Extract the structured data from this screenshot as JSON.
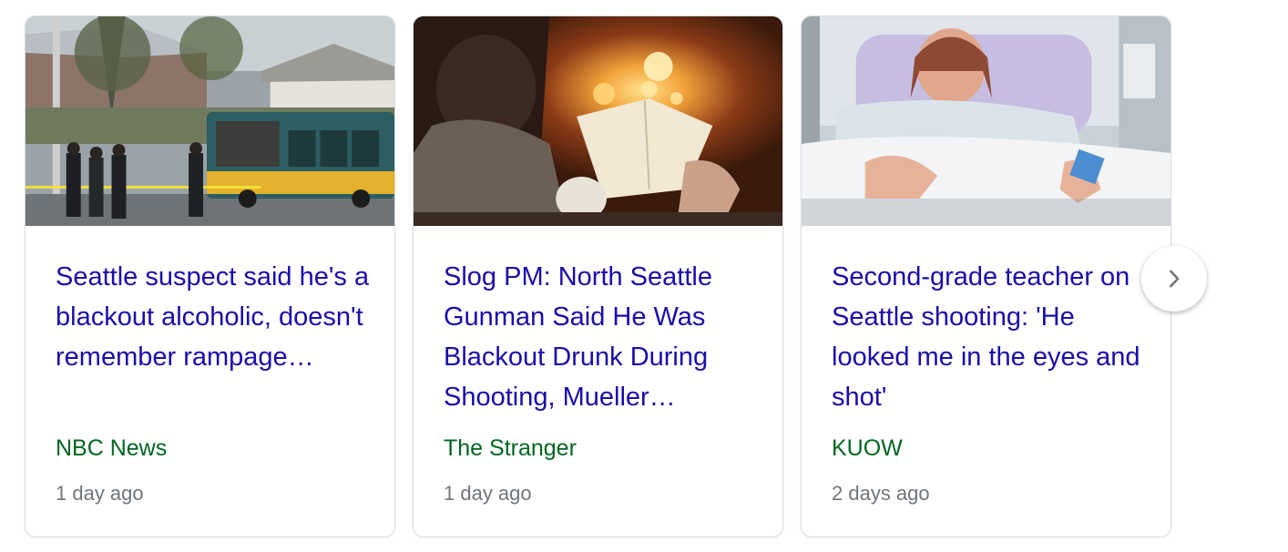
{
  "carousel": {
    "cards": [
      {
        "title": "Seattle suspect said he's a blackout alcoholic, doesn't remember rampage…",
        "source": "NBC News",
        "age": "1 day ago",
        "image_icon": "news-photo-bus-police-scene"
      },
      {
        "title": "Slog PM: North Seattle Gunman Said He Was Blackout Drunk During Shooting, Mueller…",
        "source": "The Stranger",
        "age": "1 day ago",
        "image_icon": "news-photo-reading-by-fire"
      },
      {
        "title": "Second-grade teacher on Seattle shooting: 'He looked me in the eyes and shot'",
        "source": "KUOW",
        "age": "2 days ago",
        "image_icon": "news-photo-hospital-bed"
      }
    ],
    "next_icon": "chevron-right-icon"
  },
  "colors": {
    "title": "#1a0dab",
    "source": "#006621",
    "age": "#70757a",
    "border": "#dadce0"
  }
}
